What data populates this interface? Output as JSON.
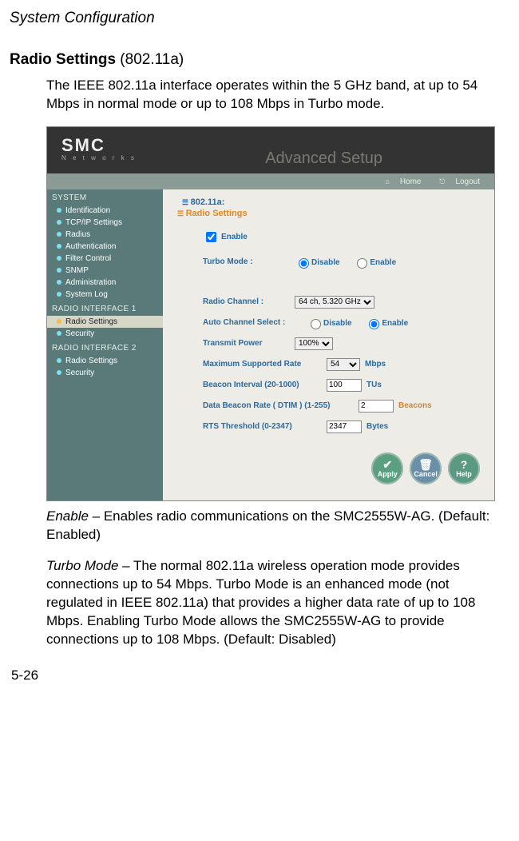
{
  "header_title": "System Configuration",
  "section": {
    "title_bold": "Radio Settings",
    "title_rest": " (802.11a)"
  },
  "intro": "The IEEE 802.11a interface operates within the 5 GHz band, at up to 54 Mbps in normal mode or up to 108 Mbps in Turbo mode.",
  "screenshot": {
    "logo": "SMC",
    "logo_sub": "N e t w o r k s",
    "banner": "Advanced Setup",
    "toolbar": {
      "home": "Home",
      "logout": "Logout"
    },
    "sidebar": {
      "system_label": "SYSTEM",
      "system_items": [
        "Identification",
        "TCP/IP Settings",
        "Radius",
        "Authentication",
        "Filter Control",
        "SNMP",
        "Administration",
        "System Log"
      ],
      "ri1_label": "RADIO INTERFACE 1",
      "ri1_items": [
        "Radio Settings",
        "Security"
      ],
      "ri2_label": "RADIO INTERFACE 2",
      "ri2_items": [
        "Radio Settings",
        "Security"
      ],
      "ri1_selected_index": 0
    },
    "crumb1": "802.11a:",
    "crumb2": "Radio Settings",
    "form": {
      "enable_label": "Enable",
      "enable_checked": true,
      "turbo": {
        "label": "Turbo Mode :",
        "disable": "Disable",
        "enable": "Enable",
        "value": "disable"
      },
      "radio_channel": {
        "label": "Radio Channel :",
        "value": "64 ch, 5.320 GHz"
      },
      "auto_channel": {
        "label": "Auto Channel Select :",
        "disable": "Disable",
        "enable": "Enable",
        "value": "enable"
      },
      "tx_power": {
        "label": "Transmit Power",
        "value": "100%"
      },
      "max_rate": {
        "label": "Maximum Supported Rate",
        "value": "54",
        "unit": "Mbps"
      },
      "beacon": {
        "label": "Beacon Interval (20-1000)",
        "value": "100",
        "unit": "TUs"
      },
      "dtim": {
        "label": "Data Beacon Rate ( DTIM ) (1-255)",
        "value": "2",
        "unit": "Beacons"
      },
      "rts": {
        "label": "RTS Threshold (0-2347)",
        "value": "2347",
        "unit": "Bytes"
      }
    },
    "buttons": {
      "apply": "Apply",
      "cancel": "Cancel",
      "help": "Help"
    }
  },
  "captions": {
    "enable": {
      "term": "Enable",
      "rest": " – Enables radio communications on the SMC2555W-AG. (Default: Enabled)"
    },
    "turbo": {
      "term": "Turbo Mode",
      "rest": " – The normal 802.11a wireless operation mode provides connections up to 54 Mbps. Turbo Mode is an enhanced mode (not regulated in IEEE 802.11a) that provides a higher data rate of up to 108 Mbps. Enabling Turbo Mode allows the SMC2555W-AG to provide connections up to 108 Mbps. (Default: Disabled)"
    }
  },
  "page_number": "5-26"
}
